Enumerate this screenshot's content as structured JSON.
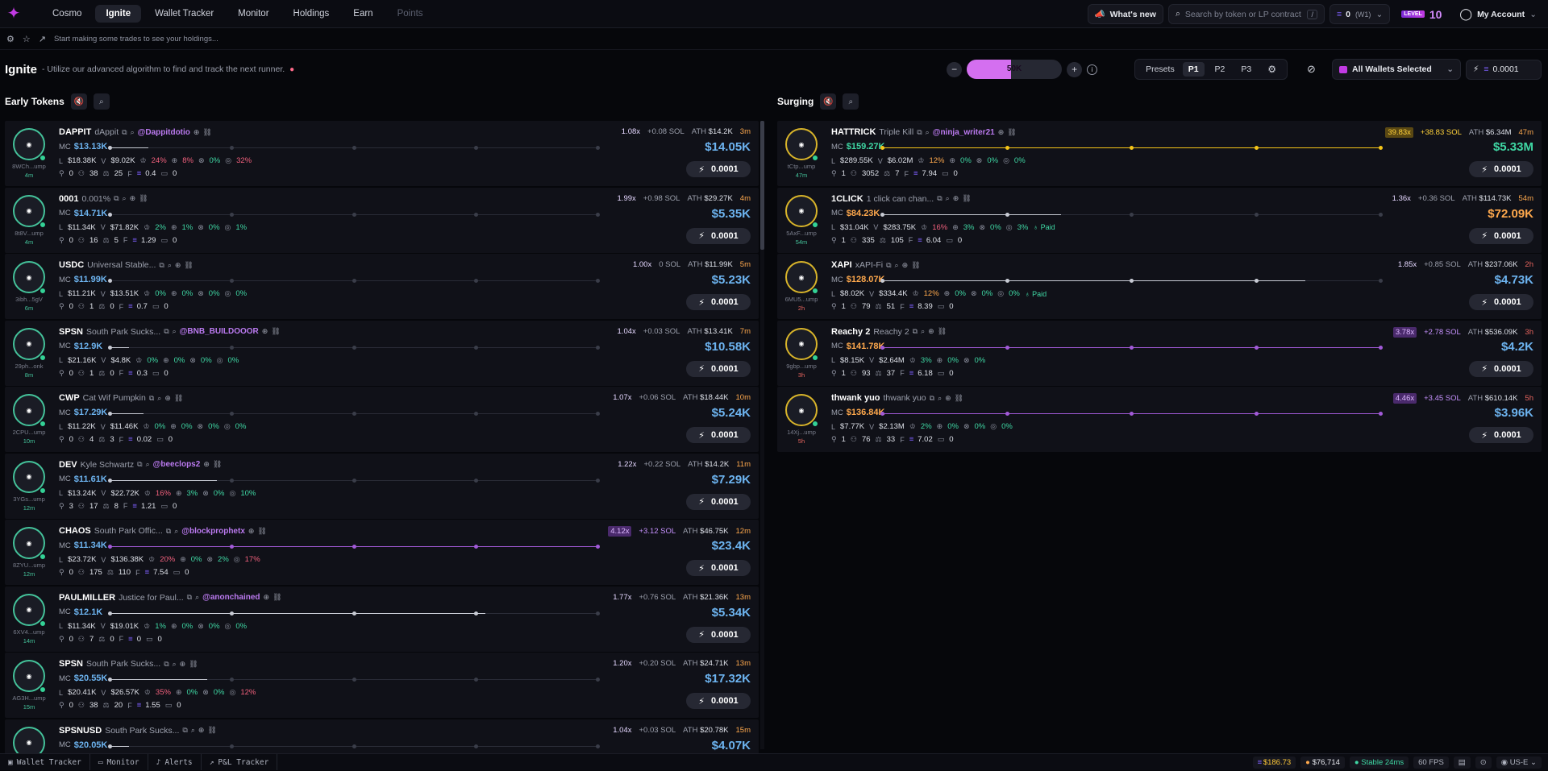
{
  "nav": {
    "items": [
      "Cosmo",
      "Ignite",
      "Wallet Tracker",
      "Monitor",
      "Holdings",
      "Earn",
      "Points"
    ],
    "active": "Ignite",
    "whats_new": "What's new",
    "search_placeholder": "Search by token or LP contract",
    "search_kbd": "/",
    "balance": "0",
    "balance_wallet": "(W1)",
    "level_badge": "LEVEL",
    "level_num": "10",
    "account": "My Account"
  },
  "subbar": {
    "text": "Start making some trades to see your holdings..."
  },
  "header": {
    "title": "Ignite",
    "subtitle": "- Utilize our advanced algorithm to find and track the next runner.",
    "slider_value": "50K",
    "presets_label": "Presets",
    "presets": [
      "P1",
      "P2",
      "P3"
    ],
    "wallets": "All Wallets Selected",
    "sol_amount": "0.0001"
  },
  "sections": {
    "left": "Early Tokens",
    "right": "Surging"
  },
  "buy_label": "0.0001",
  "early": [
    {
      "ticker": "DAPPIT",
      "name": "dAppit",
      "handle": "@Dappitdotio",
      "addr": "8WCh...ump",
      "age": "4m",
      "mc": "$13.13K",
      "liq": "$18.38K",
      "vol": "$9.02K",
      "p1": "24%",
      "p2": "8%",
      "p3": "0%",
      "p4": "32%",
      "h": "0",
      "t": "38",
      "b": "25",
      "f": "0.4",
      "c": "0",
      "mult": "1.08x",
      "delta": "+0.08 SOL",
      "ath": "$14.2K",
      "age2": "3m",
      "big": "$14.05K",
      "fill": 0.08,
      "p1c": "r",
      "p2c": "r",
      "p3c": "g",
      "p4c": "r"
    },
    {
      "ticker": "0001",
      "name": "0.001%",
      "handle": "",
      "addr": "8t8V...ump",
      "age": "4m",
      "mc": "$14.71K",
      "liq": "$11.34K",
      "vol": "$71.82K",
      "p1": "2%",
      "p2": "1%",
      "p3": "0%",
      "p4": "1%",
      "h": "0",
      "t": "16",
      "b": "5",
      "f": "1.29",
      "c": "0",
      "mult": "1.99x",
      "delta": "+0.98 SOL",
      "ath": "$29.27K",
      "age2": "4m",
      "big": "$5.35K",
      "fill": 0.0,
      "p1c": "g",
      "p2c": "g",
      "p3c": "g",
      "p4c": "g"
    },
    {
      "ticker": "USDC",
      "name": "Universal Stable...",
      "handle": "",
      "addr": "3ibh...5gV",
      "age": "6m",
      "mc": "$11.99K",
      "liq": "$11.21K",
      "vol": "$13.51K",
      "p1": "0%",
      "p2": "0%",
      "p3": "0%",
      "p4": "0%",
      "h": "0",
      "t": "1",
      "b": "0",
      "f": "0.7",
      "c": "0",
      "mult": "1.00x",
      "delta": "0 SOL",
      "ath": "$11.99K",
      "age2": "5m",
      "big": "$5.23K",
      "fill": 0.0,
      "p1c": "g",
      "p2c": "g",
      "p3c": "g",
      "p4c": "g"
    },
    {
      "ticker": "SPSN",
      "name": "South Park Sucks...",
      "handle": "@BNB_BUILDOOOR",
      "addr": "29ph...onk",
      "age": "8m",
      "mc": "$12.9K",
      "liq": "$21.16K",
      "vol": "$4.8K",
      "p1": "0%",
      "p2": "0%",
      "p3": "0%",
      "p4": "0%",
      "h": "0",
      "t": "1",
      "b": "0",
      "f": "0.3",
      "c": "0",
      "mult": "1.04x",
      "delta": "+0.03 SOL",
      "ath": "$13.41K",
      "age2": "7m",
      "big": "$10.58K",
      "fill": 0.04,
      "p1c": "g",
      "p2c": "g",
      "p3c": "g",
      "p4c": "g"
    },
    {
      "ticker": "CWP",
      "name": "Cat Wif Pumpkin",
      "handle": "",
      "addr": "2CPU...ump",
      "age": "10m",
      "mc": "$17.29K",
      "liq": "$11.22K",
      "vol": "$11.46K",
      "p1": "0%",
      "p2": "0%",
      "p3": "0%",
      "p4": "0%",
      "h": "0",
      "t": "4",
      "b": "3",
      "f": "0.02",
      "c": "0",
      "mult": "1.07x",
      "delta": "+0.06 SOL",
      "ath": "$18.44K",
      "age2": "10m",
      "big": "$5.24K",
      "fill": 0.07,
      "p1c": "g",
      "p2c": "g",
      "p3c": "g",
      "p4c": "g"
    },
    {
      "ticker": "DEV",
      "name": "Kyle Schwartz",
      "handle": "@beeclops2",
      "addr": "3YGs...ump",
      "age": "12m",
      "mc": "$11.61K",
      "liq": "$13.24K",
      "vol": "$22.72K",
      "p1": "16%",
      "p2": "3%",
      "p3": "0%",
      "p4": "10%",
      "h": "3",
      "t": "17",
      "b": "8",
      "f": "1.21",
      "c": "0",
      "mult": "1.22x",
      "delta": "+0.22 SOL",
      "ath": "$14.2K",
      "age2": "11m",
      "big": "$7.29K",
      "fill": 0.22,
      "p1c": "r",
      "p2c": "g",
      "p3c": "g",
      "p4c": "g"
    },
    {
      "ticker": "CHAOS",
      "name": "South Park Offic...",
      "handle": "@blockprophetx",
      "addr": "8ZYU...ump",
      "age": "12m",
      "mc": "$11.34K",
      "liq": "$23.72K",
      "vol": "$136.38K",
      "p1": "20%",
      "p2": "0%",
      "p3": "2%",
      "p4": "17%",
      "h": "0",
      "t": "175",
      "b": "110",
      "f": "7.54",
      "c": "0",
      "mult": "4.12x",
      "delta": "+3.12 SOL",
      "ath": "$46.75K",
      "age2": "12m",
      "big": "$23.4K",
      "fill": 1.0,
      "hot": "hot",
      "p1c": "r",
      "p2c": "g",
      "p3c": "g",
      "p4c": "r"
    },
    {
      "ticker": "PAULMILLER",
      "name": "Justice for Paul...",
      "handle": "@anonchained",
      "addr": "6XV4...ump",
      "age": "14m",
      "mc": "$12.1K",
      "liq": "$11.34K",
      "vol": "$19.01K",
      "p1": "1%",
      "p2": "0%",
      "p3": "0%",
      "p4": "0%",
      "h": "0",
      "t": "7",
      "b": "0",
      "f": "0",
      "c": "0",
      "mult": "1.77x",
      "delta": "+0.76 SOL",
      "ath": "$21.36K",
      "age2": "13m",
      "big": "$5.34K",
      "fill": 0.77,
      "p1c": "g",
      "p2c": "g",
      "p3c": "g",
      "p4c": "g"
    },
    {
      "ticker": "SPSN",
      "name": "South Park Sucks...",
      "handle": "",
      "addr": "AG3H...ump",
      "age": "15m",
      "mc": "$20.55K",
      "liq": "$20.41K",
      "vol": "$26.57K",
      "p1": "35%",
      "p2": "0%",
      "p3": "0%",
      "p4": "12%",
      "h": "0",
      "t": "38",
      "b": "20",
      "f": "1.55",
      "c": "0",
      "mult": "1.20x",
      "delta": "+0.20 SOL",
      "ath": "$24.71K",
      "age2": "13m",
      "big": "$17.32K",
      "fill": 0.2,
      "p1c": "r",
      "p2c": "g",
      "p3c": "g",
      "p4c": "r"
    },
    {
      "ticker": "SPSNUSD",
      "name": "South Park Sucks...",
      "handle": "",
      "addr": "",
      "age": "",
      "mc": "$20.05K",
      "liq": "",
      "vol": "",
      "p1": "",
      "p2": "",
      "p3": "",
      "p4": "",
      "h": "",
      "t": "",
      "b": "",
      "f": "",
      "c": "",
      "mult": "1.04x",
      "delta": "+0.03 SOL",
      "ath": "$20.78K",
      "age2": "15m",
      "big": "$4.07K",
      "fill": 0.04,
      "p1c": "g",
      "p2c": "g",
      "p3c": "g",
      "p4c": "g"
    }
  ],
  "surging": [
    {
      "ticker": "HATTRICK",
      "name": "Triple Kill",
      "handle": "@ninja_writer21",
      "addr": "tCtp...ump",
      "age": "47m",
      "mc": "$159.27K",
      "liq": "$289.55K",
      "vol": "$6.02M",
      "p1": "12%",
      "p2": "0%",
      "p3": "0%",
      "p4": "0%",
      "h": "1",
      "t": "3052",
      "b": "7",
      "f": "7.94",
      "c": "0",
      "mult": "39.83x",
      "delta": "+38.83 SOL",
      "ath": "$6.34M",
      "age2": "47m",
      "big": "$5.33M",
      "fill": 1.0,
      "hot": "gold",
      "mcc": "green",
      "bigc": "green",
      "p1c": "o",
      "p2c": "g",
      "p3c": "g",
      "p4c": "g"
    },
    {
      "ticker": "1CLICK",
      "name": "1 click can chan...",
      "handle": "",
      "addr": "5AxF...ump",
      "age": "54m",
      "mc": "$84.23K",
      "liq": "$31.04K",
      "vol": "$283.75K",
      "p1": "16%",
      "p2": "3%",
      "p3": "0%",
      "p4": "3%",
      "paid": "Paid",
      "h": "1",
      "t": "335",
      "b": "105",
      "f": "6.04",
      "c": "0",
      "mult": "1.36x",
      "delta": "+0.36 SOL",
      "ath": "$114.73K",
      "age2": "54m",
      "big": "$72.09K",
      "fill": 0.36,
      "mcc": "orange",
      "bigc": "orange",
      "p1c": "r",
      "p2c": "g",
      "p3c": "g",
      "p4c": "g"
    },
    {
      "ticker": "XAPI",
      "name": "xAPI-Fi",
      "handle": "",
      "addr": "6MU5...ump",
      "age": "2h",
      "mc": "$128.07K",
      "liq": "$8.02K",
      "vol": "$334.4K",
      "p1": "12%",
      "p2": "0%",
      "p3": "0%",
      "p4": "0%",
      "paid": "Paid",
      "h": "1",
      "t": "79",
      "b": "51",
      "f": "8.39",
      "c": "0",
      "mult": "1.85x",
      "delta": "+0.85 SOL",
      "ath": "$237.06K",
      "age2": "2h",
      "big": "$4.73K",
      "fill": 0.85,
      "mcc": "orange",
      "bigc": "",
      "ager": "red",
      "p1c": "o",
      "p2c": "g",
      "p3c": "g",
      "p4c": "g"
    },
    {
      "ticker": "Reachy 2",
      "name": "Reachy 2",
      "handle": "",
      "addr": "9gbp...ump",
      "age": "3h",
      "mc": "$141.78K",
      "liq": "$8.15K",
      "vol": "$2.64M",
      "p1": "3%",
      "p2": "0%",
      "p3": "0%",
      "p4": "",
      "h": "1",
      "t": "93",
      "b": "37",
      "f": "6.18",
      "c": "0",
      "mult": "3.78x",
      "delta": "+2.78 SOL",
      "ath": "$536.09K",
      "age2": "3h",
      "big": "$4.2K",
      "fill": 1.0,
      "hot": "hot",
      "mcc": "orange",
      "bigc": "",
      "ager": "red",
      "p1c": "g",
      "p2c": "g",
      "p3c": "g",
      "p4c": "g"
    },
    {
      "ticker": "thwank yuo",
      "name": "thwank yuo",
      "handle": "",
      "addr": "14Xj...ump",
      "age": "5h",
      "mc": "$136.84K",
      "liq": "$7.77K",
      "vol": "$2.13M",
      "p1": "2%",
      "p2": "0%",
      "p3": "0%",
      "p4": "0%",
      "h": "1",
      "t": "76",
      "b": "33",
      "f": "7.02",
      "c": "0",
      "mult": "4.46x",
      "delta": "+3.45 SOL",
      "ath": "$610.14K",
      "age2": "5h",
      "big": "$3.96K",
      "fill": 1.0,
      "hot": "hot",
      "mcc": "orange",
      "bigc": "",
      "ager": "red",
      "p1c": "g",
      "p2c": "g",
      "p3c": "g",
      "p4c": "g"
    }
  ],
  "footer": {
    "items": [
      "Wallet Tracker",
      "Monitor",
      "Alerts",
      "P&L Tracker"
    ],
    "sol_price": "$186.73",
    "btc": "$76,714",
    "stable": "Stable 24ms",
    "fps": "60 FPS",
    "region": "US-E"
  }
}
